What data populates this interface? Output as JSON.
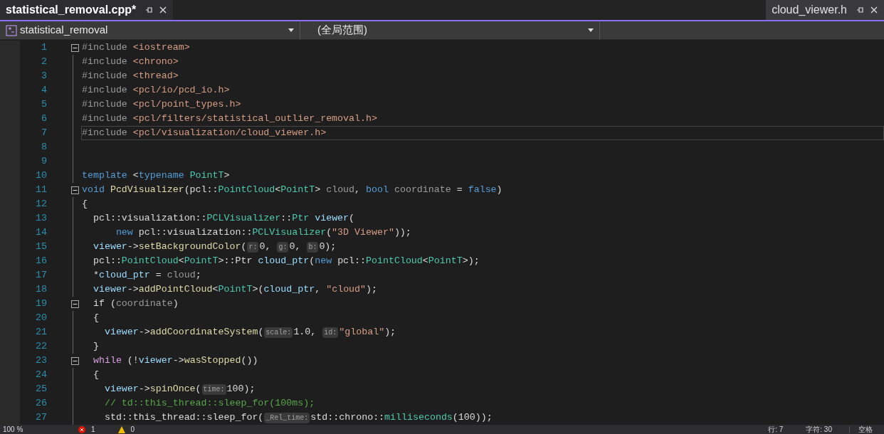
{
  "tabs": [
    {
      "label": "statistical_removal.cpp*",
      "selected": true
    },
    {
      "label": "cloud_viewer.h",
      "selected": false
    }
  ],
  "navigation_bar": {
    "project": "statistical_removal",
    "scope": "(全局范围)"
  },
  "editor": {
    "lines": [
      {
        "number": "1",
        "fold": true,
        "current": false,
        "tokens": [
          {
            "kind": "pp",
            "text": "#include "
          },
          {
            "kind": "str",
            "text": "<iostream>"
          }
        ]
      },
      {
        "number": "2",
        "fold": false,
        "current": false,
        "tokens": [
          {
            "kind": "pp",
            "text": "#include "
          },
          {
            "kind": "str",
            "text": "<chrono>"
          }
        ]
      },
      {
        "number": "3",
        "fold": false,
        "current": false,
        "tokens": [
          {
            "kind": "pp",
            "text": "#include "
          },
          {
            "kind": "str",
            "text": "<thread>"
          }
        ]
      },
      {
        "number": "4",
        "fold": false,
        "current": false,
        "tokens": [
          {
            "kind": "pp",
            "text": "#include "
          },
          {
            "kind": "str",
            "text": "<pcl/io/pcd_io.h>"
          }
        ]
      },
      {
        "number": "5",
        "fold": false,
        "current": false,
        "tokens": [
          {
            "kind": "pp",
            "text": "#include "
          },
          {
            "kind": "str",
            "text": "<pcl/point_types.h>"
          }
        ]
      },
      {
        "number": "6",
        "fold": false,
        "current": false,
        "tokens": [
          {
            "kind": "pp",
            "text": "#include "
          },
          {
            "kind": "str",
            "text": "<pcl/filters/statistical_outlier_removal.h>"
          }
        ]
      },
      {
        "number": "7",
        "fold": false,
        "current": true,
        "tokens": [
          {
            "kind": "pp",
            "text": "#include "
          },
          {
            "kind": "str",
            "text": "<pcl/visualization/cloud_viewer.h>"
          }
        ]
      },
      {
        "number": "8",
        "fold": false,
        "current": false
      },
      {
        "number": "9",
        "fold": false,
        "current": false
      },
      {
        "number": "10",
        "fold": false,
        "current": false,
        "tokens": [
          {
            "kind": "kw",
            "text": "template "
          },
          {
            "kind": "p",
            "text": "<"
          },
          {
            "kind": "kw",
            "text": "typename "
          },
          {
            "kind": "ty",
            "text": "PointT"
          },
          {
            "kind": "p",
            "text": ">"
          }
        ]
      },
      {
        "number": "11",
        "fold": true,
        "current": false,
        "tokens": [
          {
            "kind": "kw",
            "text": "void "
          },
          {
            "kind": "fn",
            "text": "PcdVisualizer"
          },
          {
            "kind": "p",
            "text": "(pcl::"
          },
          {
            "kind": "ty",
            "text": "PointCloud"
          },
          {
            "kind": "p",
            "text": "<"
          },
          {
            "kind": "ty",
            "text": "PointT"
          },
          {
            "kind": "p",
            "text": "> "
          },
          {
            "kind": "param",
            "text": "cloud"
          },
          {
            "kind": "p",
            "text": ", "
          },
          {
            "kind": "kw",
            "text": "bool "
          },
          {
            "kind": "param",
            "text": "coordinate"
          },
          {
            "kind": "p",
            "text": " = "
          },
          {
            "kind": "kw",
            "text": "false"
          },
          {
            "kind": "p",
            "text": ")"
          }
        ]
      },
      {
        "number": "12",
        "fold": false,
        "current": false,
        "tokens": [
          {
            "kind": "p",
            "text": "{"
          }
        ]
      },
      {
        "number": "13",
        "fold": false,
        "current": false,
        "tokens": [
          {
            "kind": "p",
            "text": "  pcl::visualization::"
          },
          {
            "kind": "ty",
            "text": "PCLVisualizer"
          },
          {
            "kind": "p",
            "text": "::"
          },
          {
            "kind": "ty",
            "text": "Ptr "
          },
          {
            "kind": "var",
            "text": "viewer"
          },
          {
            "kind": "p",
            "text": "("
          }
        ]
      },
      {
        "number": "14",
        "fold": false,
        "current": false,
        "tokens": [
          {
            "kind": "kw",
            "text": "      new "
          },
          {
            "kind": "p",
            "text": "pcl::visualization::"
          },
          {
            "kind": "ty",
            "text": "PCLVisualizer"
          },
          {
            "kind": "p",
            "text": "("
          },
          {
            "kind": "str",
            "text": "\"3D Viewer\""
          },
          {
            "kind": "p",
            "text": "));"
          }
        ]
      },
      {
        "number": "15",
        "fold": false,
        "current": false,
        "tokens": [
          {
            "kind": "var",
            "text": "  viewer"
          },
          {
            "kind": "p",
            "text": "->"
          },
          {
            "kind": "fn",
            "text": "setBackgroundColor"
          },
          {
            "kind": "p",
            "text": "("
          },
          {
            "kind": "hint",
            "text": "r:"
          },
          {
            "kind": "p",
            "text": "0, "
          },
          {
            "kind": "hint",
            "text": "g:"
          },
          {
            "kind": "p",
            "text": "0, "
          },
          {
            "kind": "hint",
            "text": "b:"
          },
          {
            "kind": "p",
            "text": "0);"
          }
        ]
      },
      {
        "number": "16",
        "fold": false,
        "current": false,
        "tokens": [
          {
            "kind": "p",
            "text": "  pcl::"
          },
          {
            "kind": "ty",
            "text": "PointCloud"
          },
          {
            "kind": "p",
            "text": "<"
          },
          {
            "kind": "ty",
            "text": "PointT"
          },
          {
            "kind": "p",
            "text": ">::Ptr "
          },
          {
            "kind": "var",
            "text": "cloud_ptr"
          },
          {
            "kind": "p",
            "text": "("
          },
          {
            "kind": "kw",
            "text": "new "
          },
          {
            "kind": "p",
            "text": "pcl::"
          },
          {
            "kind": "ty",
            "text": "PointCloud"
          },
          {
            "kind": "p",
            "text": "<"
          },
          {
            "kind": "ty",
            "text": "PointT"
          },
          {
            "kind": "p",
            "text": ">);"
          }
        ]
      },
      {
        "number": "17",
        "fold": false,
        "current": false,
        "tokens": [
          {
            "kind": "p",
            "text": "  *"
          },
          {
            "kind": "var",
            "text": "cloud_ptr"
          },
          {
            "kind": "p",
            "text": " = "
          },
          {
            "kind": "param",
            "text": "cloud"
          },
          {
            "kind": "p",
            "text": ";"
          }
        ]
      },
      {
        "number": "18",
        "fold": false,
        "current": false,
        "tokens": [
          {
            "kind": "var",
            "text": "  viewer"
          },
          {
            "kind": "p",
            "text": "->"
          },
          {
            "kind": "fn",
            "text": "addPointCloud"
          },
          {
            "kind": "p",
            "text": "<"
          },
          {
            "kind": "ty",
            "text": "PointT"
          },
          {
            "kind": "p",
            "text": ">("
          },
          {
            "kind": "var",
            "text": "cloud_ptr"
          },
          {
            "kind": "p",
            "text": ", "
          },
          {
            "kind": "str",
            "text": "\"cloud\""
          },
          {
            "kind": "p",
            "text": ");"
          }
        ]
      },
      {
        "number": "19",
        "fold": true,
        "current": false,
        "tokens": [
          {
            "kind": "p",
            "text": "  if ("
          },
          {
            "kind": "param",
            "text": "coordinate"
          },
          {
            "kind": "p",
            "text": ")"
          }
        ]
      },
      {
        "number": "20",
        "fold": false,
        "current": false,
        "tokens": [
          {
            "kind": "p",
            "text": "  {"
          }
        ]
      },
      {
        "number": "21",
        "fold": false,
        "current": false,
        "tokens": [
          {
            "kind": "var",
            "text": "    viewer"
          },
          {
            "kind": "p",
            "text": "->"
          },
          {
            "kind": "fn",
            "text": "addCoordinateSystem"
          },
          {
            "kind": "p",
            "text": "("
          },
          {
            "kind": "hint",
            "text": "scale:"
          },
          {
            "kind": "p",
            "text": "1.0, "
          },
          {
            "kind": "hint",
            "text": "id:"
          },
          {
            "kind": "str",
            "text": "\"global\""
          },
          {
            "kind": "p",
            "text": ");"
          }
        ]
      },
      {
        "number": "22",
        "fold": false,
        "current": false,
        "tokens": [
          {
            "kind": "p",
            "text": "  }"
          }
        ]
      },
      {
        "number": "23",
        "fold": true,
        "current": false,
        "tokens": [
          {
            "kind": "ctrl",
            "text": "  while"
          },
          {
            "kind": "p",
            "text": " (!"
          },
          {
            "kind": "var",
            "text": "viewer"
          },
          {
            "kind": "p",
            "text": "->"
          },
          {
            "kind": "fn",
            "text": "wasStopped"
          },
          {
            "kind": "p",
            "text": "())"
          }
        ]
      },
      {
        "number": "24",
        "fold": false,
        "current": false,
        "tokens": [
          {
            "kind": "p",
            "text": "  {"
          }
        ]
      },
      {
        "number": "25",
        "fold": false,
        "current": false,
        "tokens": [
          {
            "kind": "var",
            "text": "    viewer"
          },
          {
            "kind": "p",
            "text": "->"
          },
          {
            "kind": "fn",
            "text": "spinOnce"
          },
          {
            "kind": "p",
            "text": "("
          },
          {
            "kind": "hint",
            "text": "time:"
          },
          {
            "kind": "p",
            "text": "100);"
          }
        ]
      },
      {
        "number": "26",
        "fold": false,
        "current": false,
        "tokens": [
          {
            "kind": "cm",
            "text": "    // td::this_thread::sleep_for(100ms);"
          }
        ]
      },
      {
        "number": "27",
        "fold": false,
        "current": false,
        "tokens": [
          {
            "kind": "p",
            "text": "    std::this_thread::sleep_for("
          },
          {
            "kind": "hint",
            "text": "_Rel_time:"
          },
          {
            "kind": "p",
            "text": "std::chrono::"
          },
          {
            "kind": "ty",
            "text": "milliseconds"
          },
          {
            "kind": "p",
            "text": "(100));"
          }
        ]
      }
    ]
  },
  "status_bar": {
    "zoom": "100 %",
    "errors": "1",
    "warnings": "0",
    "line": "行: 7",
    "column": "字符: 30",
    "indent": "空格"
  }
}
